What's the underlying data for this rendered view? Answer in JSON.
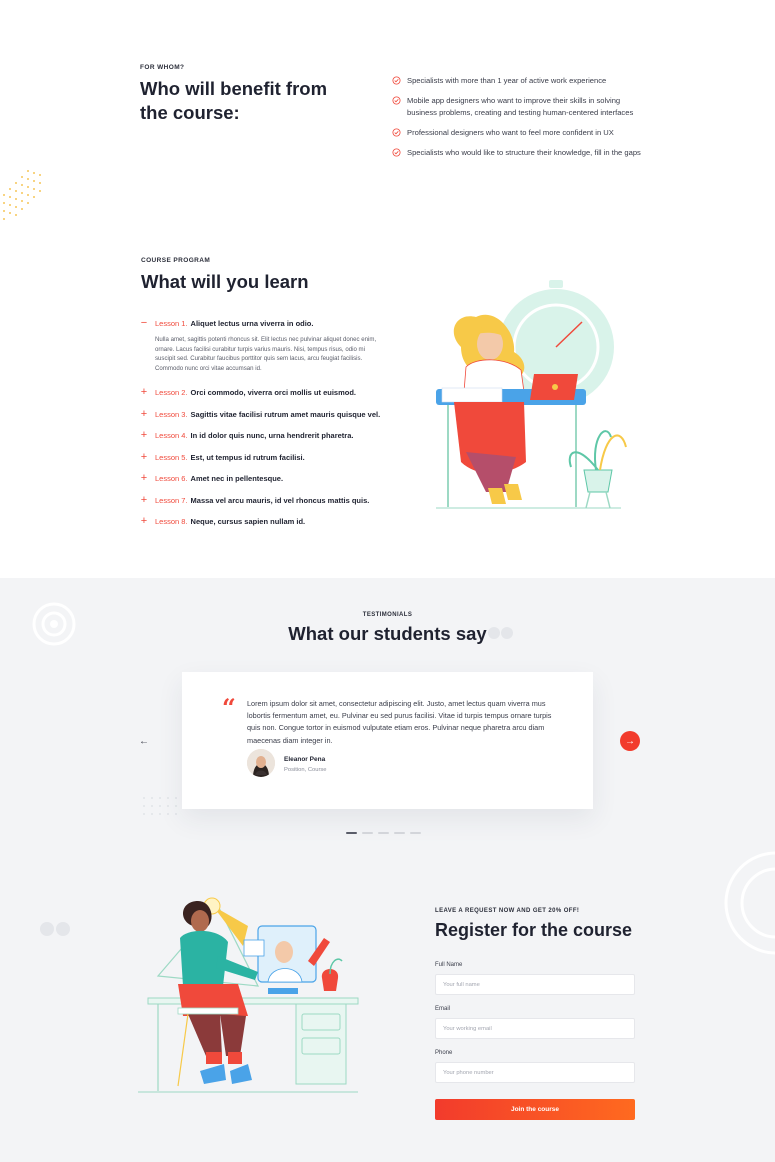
{
  "for_whom": {
    "eyebrow": "FOR WHOM?",
    "title": "Who will benefit from the course:",
    "benefits": [
      "Specialists with more than 1 year of active work experience",
      "Mobile app designers who want to improve their skills in solving business problems, creating and testing human-centered interfaces",
      "Professional designers who want to feel more confident in UX",
      "Specialists who would like to structure their knowledge, fill in the gaps"
    ]
  },
  "program": {
    "eyebrow": "COURSE PROGRAM",
    "title": "What will you learn",
    "lessons": [
      {
        "num": "Lesson 1.",
        "title": "Aliquet lectus urna viverra in odio.",
        "expanded": true,
        "body": "Nulla amet, sagittis potenti rhoncus sit. Elit lectus nec pulvinar aliquet donec enim, ornare. Lacus facilisi curabitur turpis varius mauris. Nisi, tempus risus, odio mi suscipit sed. Curabitur faucibus porttitor quis sem lacus, arcu feugiat facilisis. Commodo nunc orci vitae accumsan id."
      },
      {
        "num": "Lesson 2.",
        "title": "Orci commodo, viverra orci mollis ut euismod.",
        "expanded": false
      },
      {
        "num": "Lesson 3.",
        "title": "Sagittis vitae facilisi rutrum amet mauris quisque vel.",
        "expanded": false
      },
      {
        "num": "Lesson 4.",
        "title": "In id dolor quis nunc, urna hendrerit pharetra.",
        "expanded": false
      },
      {
        "num": "Lesson 5.",
        "title": "Est, ut tempus id rutrum facilisi.",
        "expanded": false
      },
      {
        "num": "Lesson 6.",
        "title": "Amet nec in pellentesque.",
        "expanded": false
      },
      {
        "num": "Lesson 7.",
        "title": "Massa vel arcu mauris, id vel rhoncus mattis quis.",
        "expanded": false
      },
      {
        "num": "Lesson 8.",
        "title": "Neque, cursus sapien nullam id.",
        "expanded": false
      }
    ],
    "expanded_sign": "−",
    "collapsed_sign": "+"
  },
  "testimonials": {
    "eyebrow": "TESTIMONIALS",
    "title": "What our students say",
    "quote": "Lorem ipsum dolor sit amet, consectetur adipiscing elit. Justo, amet lectus quam viverra mus lobortis fermentum amet, eu. Pulvinar eu sed purus facilisi. Vitae id turpis tempus ornare turpis quis non. Congue tortor in euismod vulputate etiam eros. Pulvinar neque pharetra arcu diam maecenas diam integer in.",
    "quote_mark": "“",
    "author": "Eleanor Pena",
    "position": "Position, Course",
    "prev_label": "←",
    "next_label": "→",
    "active_slide": 1,
    "slide_count": 5
  },
  "register": {
    "eyebrow": "LEAVE A REQUEST NOW AND GET 20% OFF!",
    "title": "Register for the course",
    "fields": {
      "name": {
        "label": "Full Name",
        "placeholder": "Your full name"
      },
      "email": {
        "label": "Email",
        "placeholder": "Your working email"
      },
      "phone": {
        "label": "Phone",
        "placeholder": "Your phone number"
      }
    },
    "submit": "Join the course"
  },
  "colors": {
    "accent": "#f0493b",
    "accent_gradient_end": "#ff6a1f",
    "heading": "#1f2230",
    "section_bg": "#f3f4f6"
  }
}
